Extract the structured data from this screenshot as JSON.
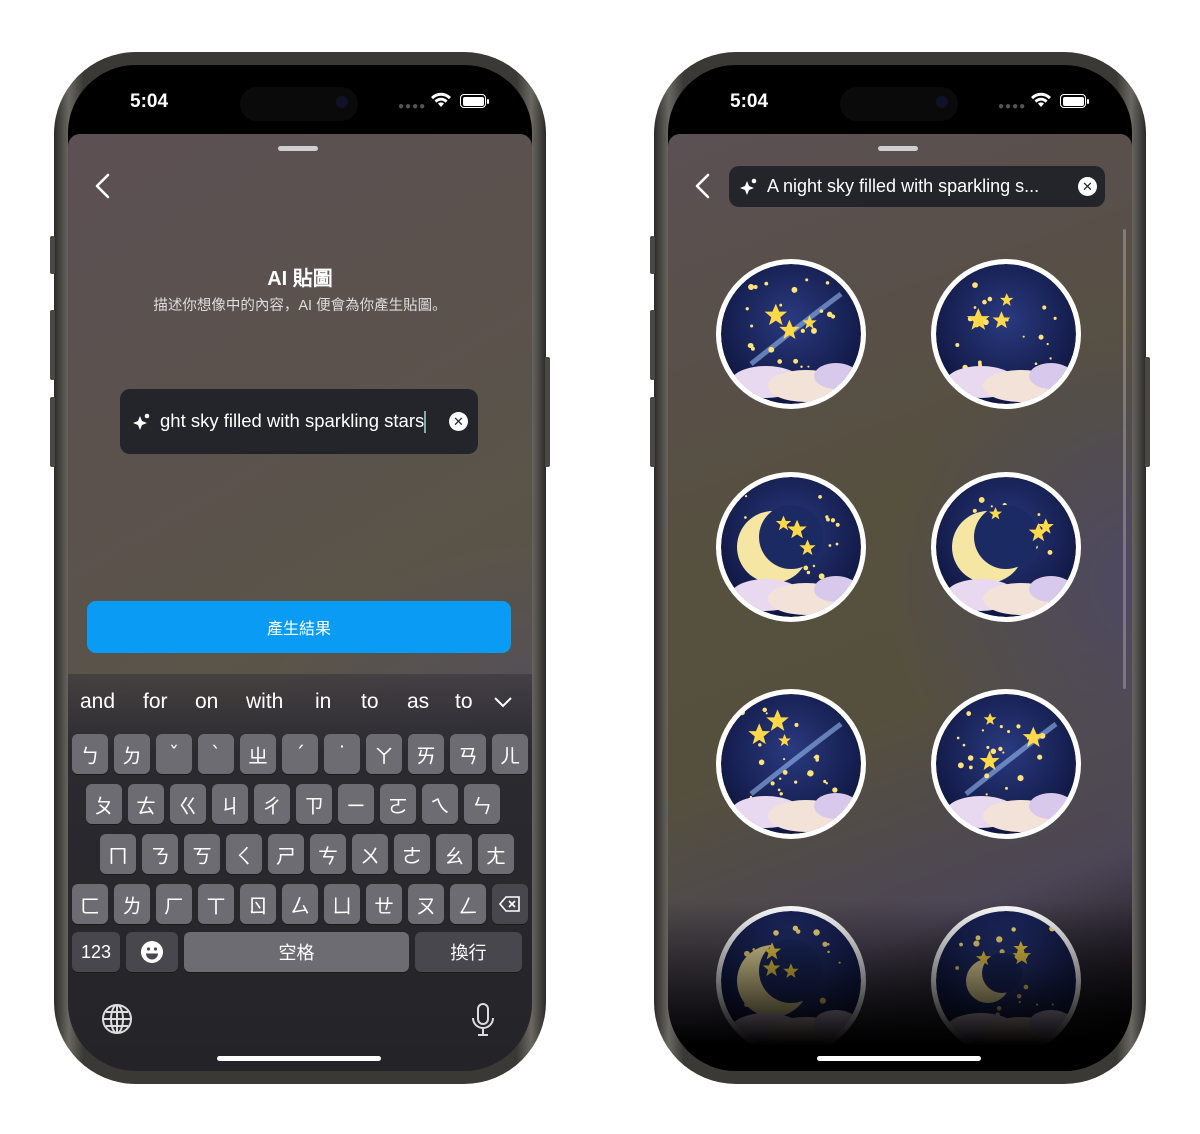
{
  "status_bar": {
    "time": "5:04"
  },
  "left_screen": {
    "title": "AI 貼圖",
    "subtitle": "描述你想像中的內容，AI 便會為你產生貼圖。",
    "prompt_value": "ght sky filled with sparkling stars",
    "generate_button": "產生結果",
    "keyboard": {
      "suggestions": [
        "and",
        "for",
        "on",
        "with",
        "in",
        "to",
        "as",
        "to"
      ],
      "rows": [
        [
          "ㄅ",
          "ㄉ",
          "ˇ",
          "ˋ",
          "ㄓ",
          "ˊ",
          "˙",
          "ㄚ",
          "ㄞ",
          "ㄢ",
          "ㄦ"
        ],
        [
          "ㄆ",
          "ㄊ",
          "ㄍ",
          "ㄐ",
          "ㄔ",
          "ㄗ",
          "ㄧ",
          "ㄛ",
          "ㄟ",
          "ㄣ"
        ],
        [
          "ㄇ",
          "ㄋ",
          "ㄎ",
          "ㄑ",
          "ㄕ",
          "ㄘ",
          "ㄨ",
          "ㄜ",
          "ㄠ",
          "ㄤ"
        ],
        [
          "ㄈ",
          "ㄌ",
          "ㄏ",
          "ㄒ",
          "ㄖ",
          "ㄙ",
          "ㄩ",
          "ㄝ",
          "ㄡ",
          "ㄥ"
        ]
      ],
      "numbers_key": "123",
      "space_key": "空格",
      "return_key": "換行"
    }
  },
  "right_screen": {
    "prompt_value": "A night sky filled with sparkling s..."
  },
  "colors": {
    "accent": "#0a9bf5",
    "input_bg": "#23252a"
  },
  "icons": [
    "back-chevron-icon",
    "sparkles-icon",
    "clear-icon",
    "emoji-icon",
    "backspace-icon",
    "globe-icon",
    "microphone-icon",
    "wifi-icon",
    "battery-icon",
    "chevron-down-icon"
  ]
}
